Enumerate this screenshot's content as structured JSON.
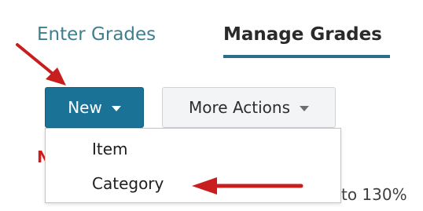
{
  "tabs": {
    "enter_grades": "Enter Grades",
    "manage_grades": "Manage Grades"
  },
  "toolbar": {
    "new_label": "New",
    "more_actions_label": "More Actions"
  },
  "dropdown": {
    "items": [
      {
        "label": "Item"
      },
      {
        "label": "Category"
      }
    ]
  },
  "background_text": "to 130%",
  "colors": {
    "tab_active_underline": "#2a6f86",
    "primary_button": "#1a7396",
    "annotation_arrow": "#c81e1e"
  }
}
